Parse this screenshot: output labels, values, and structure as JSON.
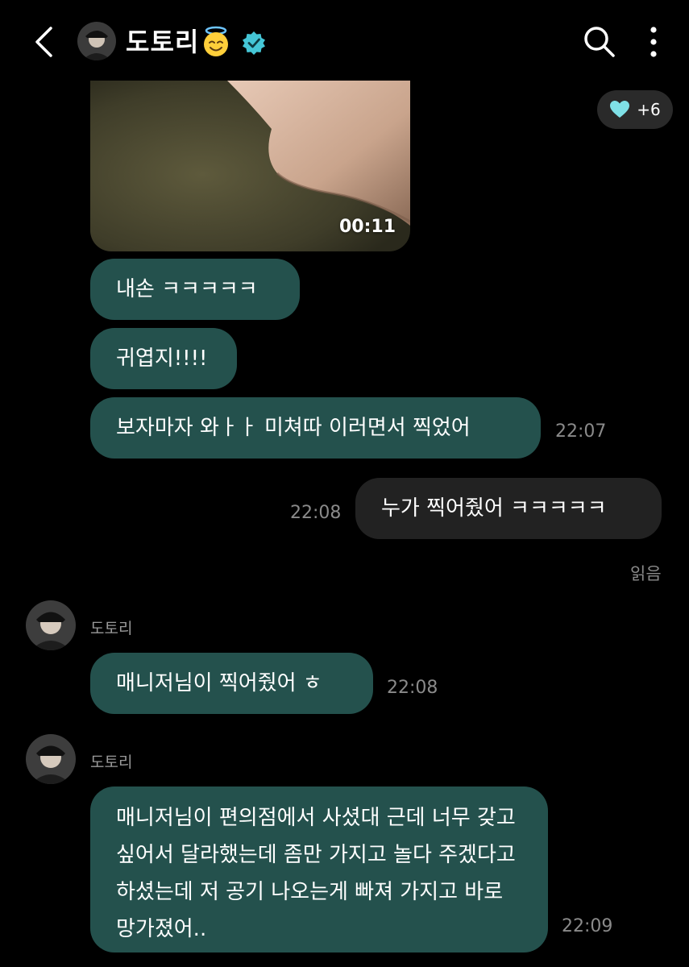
{
  "header": {
    "contact_name": "도토리",
    "emoji": "😇",
    "icons": {
      "back": "chevron-left-icon",
      "verified": "verified-badge-icon",
      "search": "search-icon",
      "more": "more-vertical-icon"
    }
  },
  "video": {
    "duration": "00:11"
  },
  "reaction": {
    "icon": "heart-icon",
    "count": "+6",
    "heart_color": "#7fe0e6"
  },
  "messages": [
    {
      "text": "내손 ㅋㅋㅋㅋㅋ"
    },
    {
      "text": "귀엽지!!!!"
    },
    {
      "text": "보자마자 와ㅏㅏ 미쳐따 이러면서 찍었어",
      "time": "22:07"
    },
    {
      "text": "누가 찍어줬어 ㅋㅋㅋㅋㅋ",
      "time": "22:08",
      "read": "읽음"
    },
    {
      "sender": "도토리",
      "text": "매니저님이 찍어줬어 ㅎ",
      "time": "22:08"
    },
    {
      "sender": "도토리",
      "text": "매니저님이 편의점에서 사셨대 근데 너무 갖고싶어서 달라했는데 좀만 가지고 놀다 주겠다고 하셨는데 저 공기 나오는게 빠져 가지고 바로망가졌어..",
      "time": "22:09"
    }
  ],
  "colors": {
    "incoming_bubble": "#24514d",
    "outgoing_bubble": "#222222",
    "verified_badge": "#45c6d6"
  }
}
